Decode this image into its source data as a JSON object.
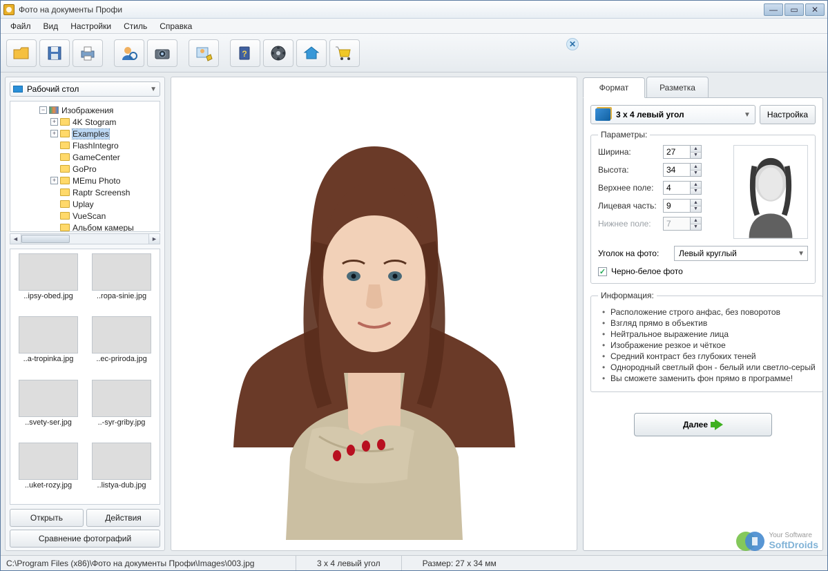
{
  "window": {
    "title": "Фото на документы Профи"
  },
  "menu": {
    "file": "Файл",
    "view": "Вид",
    "settings": "Настройки",
    "style": "Стиль",
    "help": "Справка"
  },
  "sidebar": {
    "folder_selector": "Рабочий стол",
    "tree": {
      "root": "Изображения",
      "items": [
        {
          "label": "4K Stogram",
          "expandable": true
        },
        {
          "label": "Examples",
          "expandable": true,
          "selected": true
        },
        {
          "label": "FlashIntegro",
          "expandable": false
        },
        {
          "label": "GameCenter",
          "expandable": false
        },
        {
          "label": "GoPro",
          "expandable": false
        },
        {
          "label": "MEmu Photo",
          "expandable": true
        },
        {
          "label": "Raptr Screensh",
          "expandable": false
        },
        {
          "label": "Uplay",
          "expandable": false
        },
        {
          "label": "VueScan",
          "expandable": false
        },
        {
          "label": "Альбом камеры",
          "expandable": false
        }
      ]
    },
    "thumbs": [
      "..ipsy-obed.jpg",
      "..ropa-sinie.jpg",
      "..a-tropinka.jpg",
      "..ec-priroda.jpg",
      "..svety-ser.jpg",
      "..-syr-griby.jpg",
      "..uket-rozy.jpg",
      "..listya-dub.jpg"
    ],
    "buttons": {
      "open": "Открыть",
      "actions": "Действия",
      "compare": "Сравнение фотографий"
    }
  },
  "right": {
    "tabs": {
      "format": "Формат",
      "layout": "Разметка"
    },
    "format_select": "3 x 4 левый угол",
    "settings_btn": "Настройка",
    "params_legend": "Параметры:",
    "params": {
      "width_label": "Ширина:",
      "width": "27",
      "height_label": "Высота:",
      "height": "34",
      "top_label": "Верхнее поле:",
      "top": "4",
      "face_label": "Лицевая часть:",
      "face": "9",
      "bottom_label": "Нижнее поле:",
      "bottom": "7"
    },
    "corner_label": "Уголок на фото:",
    "corner_value": "Левый круглый",
    "bw_label": "Черно-белое фото",
    "bw_checked": true,
    "info_legend": "Информация:",
    "info": [
      "Расположение строго анфас, без поворотов",
      "Взгляд прямо в объектив",
      "Нейтральное выражение лица",
      "Изображение резкое и чёткое",
      "Средний контраст без глубоких теней",
      "Однородный светлый фон - белый или светло-серый",
      "Вы сможете заменить фон прямо в программе!"
    ],
    "next": "Далее"
  },
  "status": {
    "path": "C:\\Program Files (x86)\\Фото на документы Профи\\Images\\003.jpg",
    "format": "3 x 4 левый угол",
    "size": "Размер: 27 x 34 мм"
  },
  "watermark": {
    "line1": "Your Software",
    "line2": "SoftDroids"
  }
}
